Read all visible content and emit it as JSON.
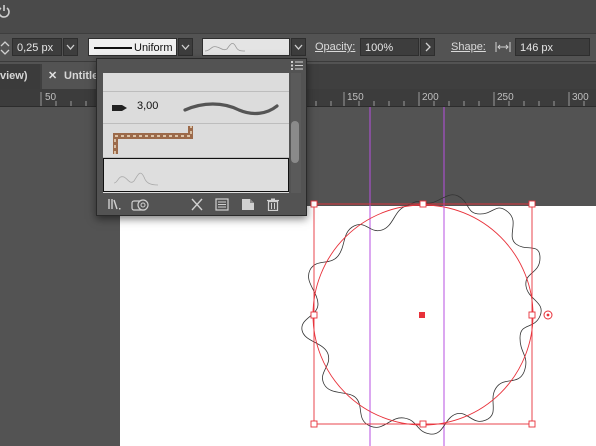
{
  "control_bar": {
    "stroke_weight": "0,25 px",
    "stroke_profile": "Uniform",
    "opacity_label": "Opacity:",
    "opacity_value": "100%",
    "shape_label": "Shape:",
    "shape_value": "146 px"
  },
  "tabs": [
    {
      "label": "view)"
    },
    {
      "label": "Untitle"
    }
  ],
  "ruler": {
    "ticks": [
      "50",
      "150",
      "200",
      "250",
      "300"
    ]
  },
  "brushes_panel": {
    "brushes": [
      {
        "type": "calligraphic",
        "size_label": "3,00"
      },
      {
        "type": "pattern"
      },
      {
        "type": "art",
        "selected": true
      }
    ]
  },
  "colors": {
    "selection": "#e8313a",
    "guide": "#b74fe0",
    "artboard": "#ffffff",
    "ui_bg": "#535353"
  }
}
